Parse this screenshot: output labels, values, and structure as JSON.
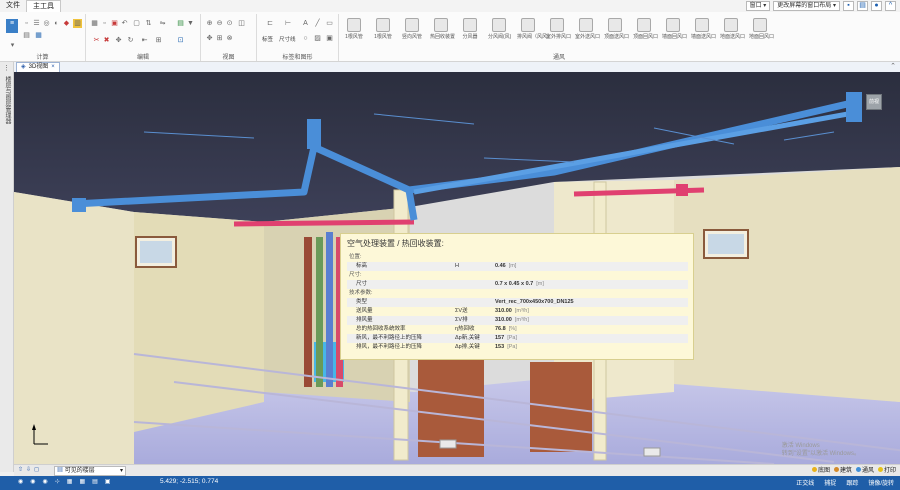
{
  "menu": {
    "file": "文件",
    "main_tools": "主工具"
  },
  "window_controls": {
    "window_menu": "窗口",
    "layout": "更改屏幕的窗口布局"
  },
  "ribbon": {
    "groups": {
      "calc": "计算",
      "edit": "编辑",
      "view": "视图",
      "annotate": "标签和图形",
      "ventilation": "通风"
    },
    "annotate_buttons": {
      "label": "标签",
      "dimension": "尺寸线"
    },
    "vent_buttons": [
      "1根风管",
      "1根风管",
      "竖向风管",
      "热回收装置",
      "分风器",
      "分风阀(风)",
      "排风阀（风风）",
      "室外排风口",
      "室外送风口",
      "顶面送风口",
      "顶面回风口",
      "墙面回风口",
      "墙面送风口",
      "地面送风口",
      "地面回风口"
    ]
  },
  "sidebar": {
    "label": "楼层与图层管理器"
  },
  "tab": {
    "title": "3D视图",
    "close": "×"
  },
  "properties": {
    "title": "空气处理装置 / 热回收装置:",
    "rows": [
      {
        "kind": "section",
        "name": "位置:"
      },
      {
        "kind": "row",
        "name": "标高",
        "symbol": "H",
        "value": "0.46",
        "unit": "[m]"
      },
      {
        "kind": "section",
        "name": "尺寸:"
      },
      {
        "kind": "row",
        "name": "尺寸",
        "symbol": "",
        "value": "0.7 x 0.45 x 0.7",
        "unit": "[m]"
      },
      {
        "kind": "section",
        "name": "技术参数:"
      },
      {
        "kind": "row",
        "name": "类型",
        "symbol": "",
        "value": "Vert_rec_700x450x700_DN125",
        "unit": ""
      },
      {
        "kind": "row",
        "name": "送风量",
        "symbol": "ΣV送",
        "value": "310.00",
        "unit": "[m³/h]"
      },
      {
        "kind": "row",
        "name": "排风量",
        "symbol": "ΣV排",
        "value": "310.00",
        "unit": "[m³/h]"
      },
      {
        "kind": "row",
        "name": "总的热回收系统效率",
        "symbol": "η热回收",
        "value": "76.8",
        "unit": "[%]"
      },
      {
        "kind": "row",
        "name": "新风，最不利路径上的压降",
        "symbol": "Δp新,关键",
        "value": "157",
        "unit": "[Pa]"
      },
      {
        "kind": "row",
        "name": "排风，最不利路径上的压降",
        "symbol": "Δp排,关键",
        "value": "153",
        "unit": "[Pa]"
      }
    ]
  },
  "view_cube": {
    "label": "前视"
  },
  "statusbar": {
    "floor_select": "可见的楼层",
    "layers": [
      {
        "label": "底图",
        "color": "#e8b21c"
      },
      {
        "label": "建筑",
        "color": "#d38a2b"
      },
      {
        "label": "通风",
        "color": "#3f8fd8"
      },
      {
        "label": "打印",
        "color": "#e6c21a"
      }
    ]
  },
  "bottombar": {
    "coords": "5.429; -2.515; 0.774",
    "right_items": [
      "正交线",
      "捕捉",
      "跟踪",
      "镜像/旋转"
    ]
  },
  "watermark": {
    "line1": "激活 Windows",
    "line2": "转到\"设置\"以激活 Windows。"
  }
}
